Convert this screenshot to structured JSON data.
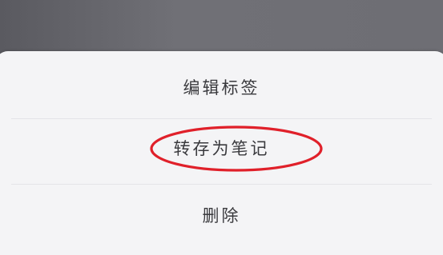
{
  "menu": {
    "items": [
      {
        "label": "编辑标签"
      },
      {
        "label": "转存为笔记"
      },
      {
        "label": "删除"
      }
    ]
  },
  "annotation": {
    "color": "#e0202a",
    "target": "转存为笔记"
  },
  "colors": {
    "sheet_background": "#f4f4f6",
    "backdrop": "#707076",
    "text": "#3a3a3e"
  }
}
